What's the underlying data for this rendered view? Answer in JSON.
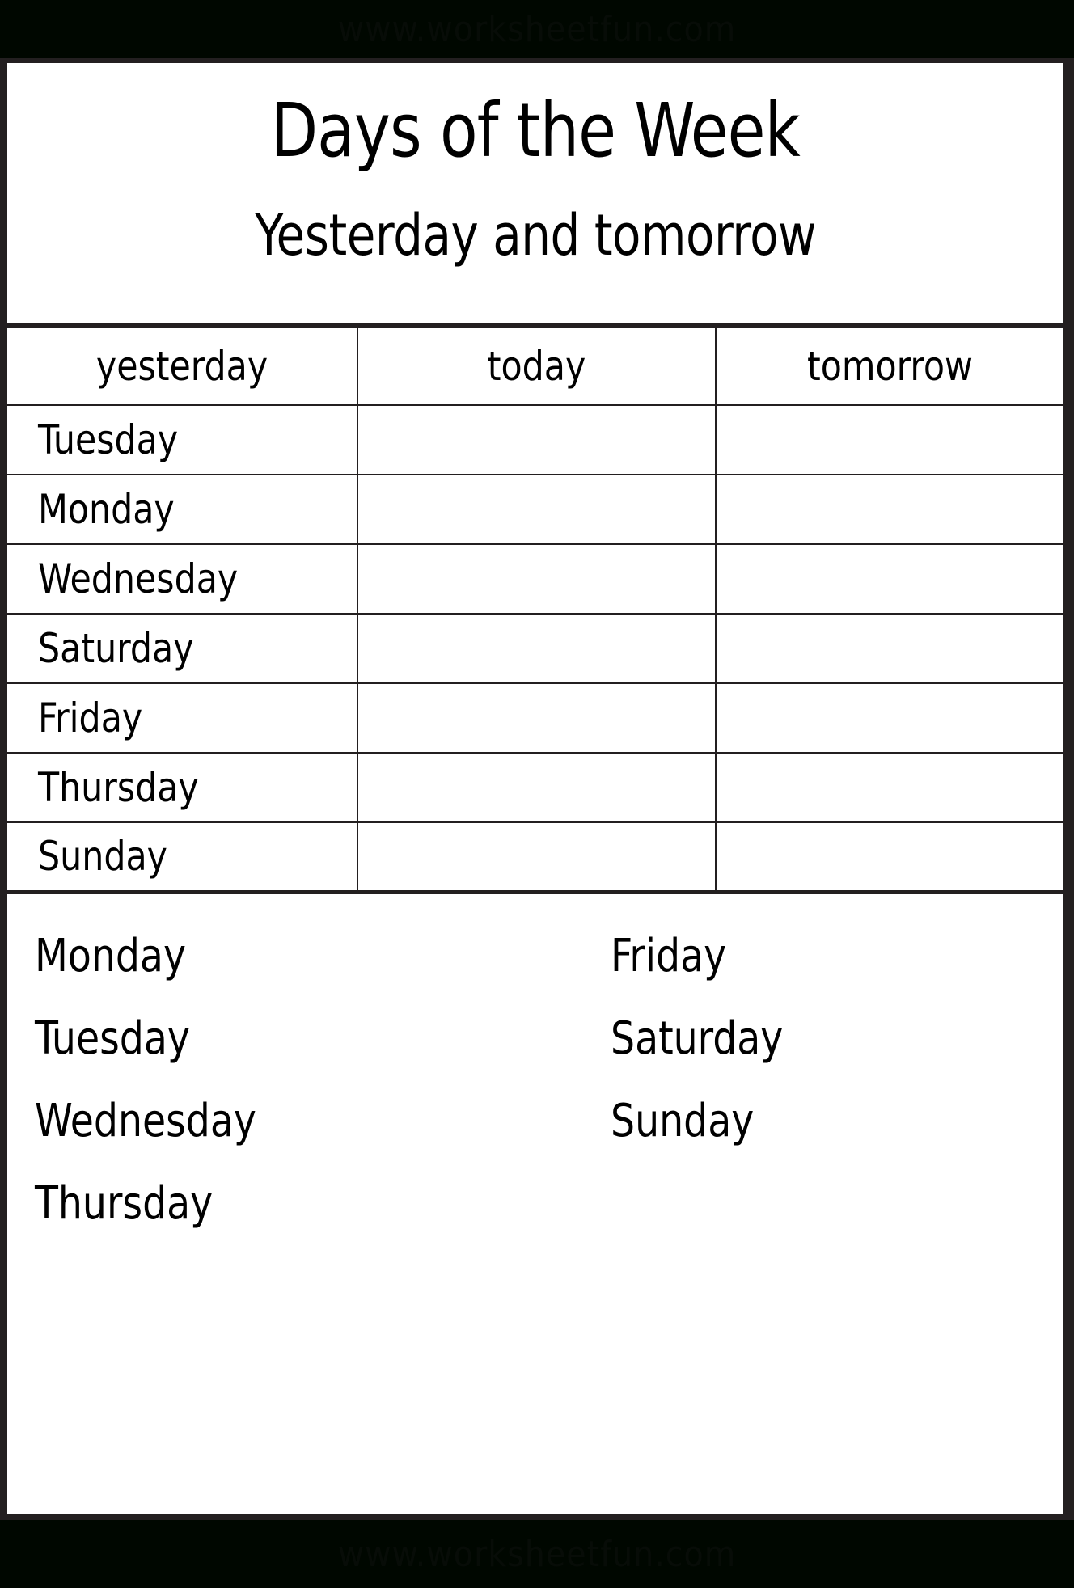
{
  "watermark": {
    "top_text": "www.worksheetfun.com",
    "bottom_text": "www.worksheetfun.com"
  },
  "header": {
    "title": "Days of the Week",
    "subtitle": "Yesterday and tomorrow"
  },
  "table": {
    "columns": [
      "yesterday",
      "today",
      "tomorrow"
    ],
    "rows": [
      {
        "yesterday": "Tuesday",
        "today": "",
        "tomorrow": ""
      },
      {
        "yesterday": "Monday",
        "today": "",
        "tomorrow": ""
      },
      {
        "yesterday": "Wednesday",
        "today": "",
        "tomorrow": ""
      },
      {
        "yesterday": "Saturday",
        "today": "",
        "tomorrow": ""
      },
      {
        "yesterday": "Friday",
        "today": "",
        "tomorrow": ""
      },
      {
        "yesterday": "Thursday",
        "today": "",
        "tomorrow": ""
      },
      {
        "yesterday": "Sunday",
        "today": "",
        "tomorrow": ""
      }
    ]
  },
  "word_bank": {
    "left_column": [
      "Monday",
      "Tuesday",
      "Wednesday",
      "Thursday"
    ],
    "right_column": [
      "Friday",
      "Saturday",
      "Sunday"
    ]
  },
  "colors": {
    "ink": "#000000",
    "rule": "#231f20",
    "paper": "#ffffff",
    "band": "#000700"
  }
}
